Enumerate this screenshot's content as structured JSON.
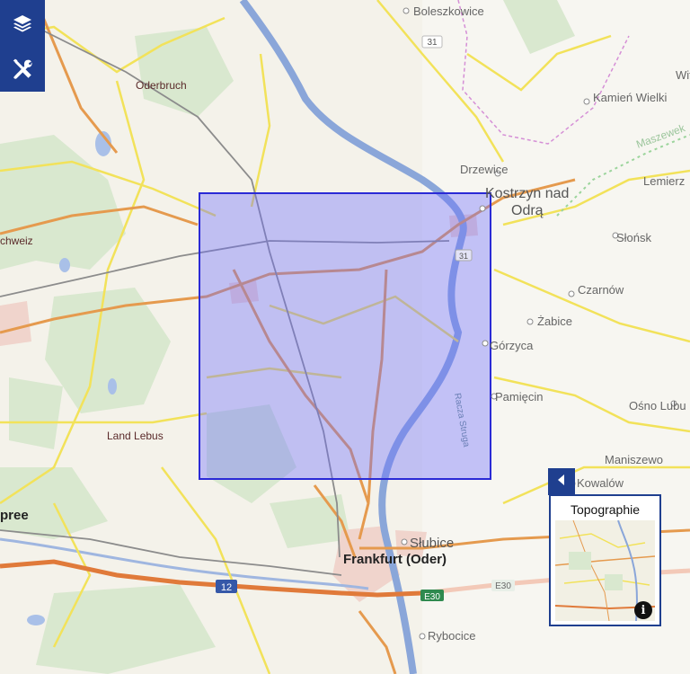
{
  "map": {
    "place_labels": {
      "boleszkowice": "Boleszkowice",
      "oderbruch": "Oderbruch",
      "kamien_wielki": "Kamień Wielki",
      "wit": "Wit",
      "maszewek": "Maszewek",
      "drzewice": "Drzewice",
      "kostrzyn_line1": "Kostrzyn nad",
      "kostrzyn_line2": "Odrą",
      "lemierz": "Lemierz",
      "schweiz": "chweiz",
      "slonsk": "Słońsk",
      "czarnow": "Czarnów",
      "zabice": "Żabice",
      "gorzyca": "Górzyca",
      "pamiecin": "Pamięcin",
      "osno_lubu": "Ośno Lubu",
      "land_lebus": "Land Lebus",
      "maniszewo": "Maniszewo",
      "kowalow": "Kowalów",
      "pree": "pree",
      "slubice": "Słubice",
      "frankfurt": "Frankfurt (Oder)",
      "rybocice": "Rybocice",
      "reka_strug": "Racza Struga"
    },
    "road_shields": {
      "r31": "31",
      "r31b": "31",
      "a12": "12",
      "e30a": "E30",
      "e30b": "E30"
    },
    "colors": {
      "background": "#f4f2ea",
      "river": "#8aa6d9",
      "forest": "#d9e8cf",
      "yellow_road": "#f2e25a",
      "orange_road": "#e59a4e",
      "motorway": "#e07a3a",
      "selection_fill": "#6b6bff",
      "selection_stroke": "#2a2ad6",
      "brand": "#1f3f8f"
    }
  },
  "toolbar": {
    "layers_icon": "layers-icon",
    "tools_icon": "tools-icon"
  },
  "overview": {
    "title": "Topographie",
    "collapse_icon": "caret-left-icon",
    "info_icon": "info-icon",
    "info_glyph": "i"
  }
}
